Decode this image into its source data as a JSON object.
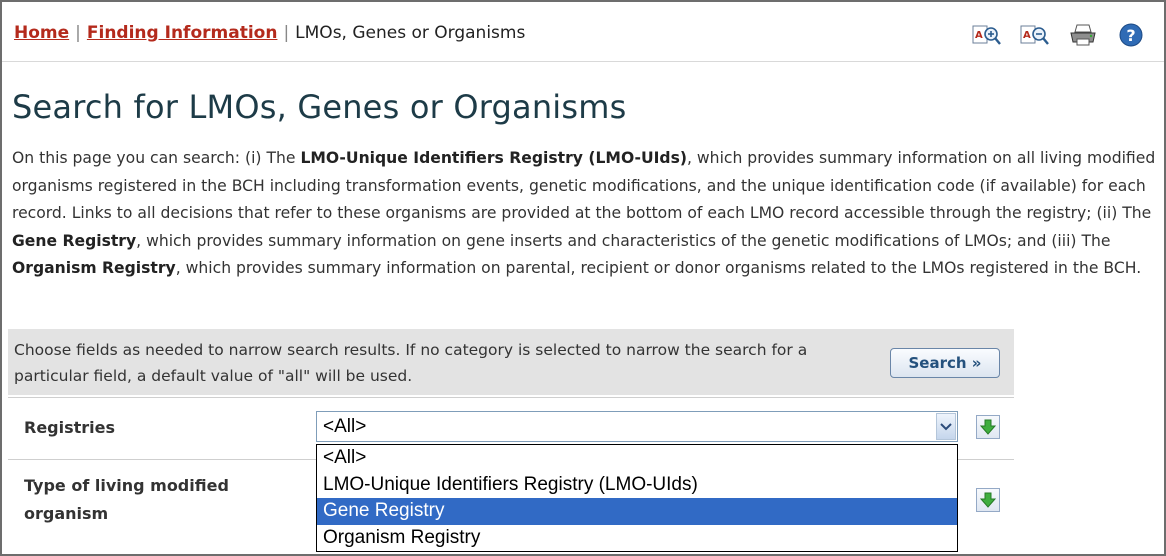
{
  "breadcrumb": {
    "home": "Home",
    "sep1": "|",
    "finding": "Finding Information",
    "sep2": "|",
    "current": "LMOs, Genes or Organisms"
  },
  "toolbar": {
    "icons": [
      "zoom-in-icon",
      "zoom-out-icon",
      "print-icon",
      "help-icon"
    ]
  },
  "page_title": "Search for LMOs, Genes or Organisms",
  "intro": {
    "t1": "On this page you can search: (i) The ",
    "b1": "LMO-Unique Identifiers Registry (LMO-UIds)",
    "t2": ", which provides summary information on all living modified organisms registered in the BCH including transformation events, genetic modifications, and the unique identification code (if available) for each record. Links to all decisions that refer to these organisms are provided at the bottom of each LMO record accessible through the registry; (ii) The ",
    "b2": "Gene Registry",
    "t3": ", which provides summary information on gene inserts and characteristics of the genetic modifications of LMOs; and (iii) The ",
    "b3": "Organism Registry",
    "t4": ", which provides summary information on parental, recipient or donor organisms related to the LMOs registered in the BCH."
  },
  "search": {
    "hint": "Choose fields as needed to narrow search results. If no category is selected to narrow the search for a particular field, a default value of \"all\" will be used.",
    "button": "Search »"
  },
  "fields": {
    "registries_label": "Registries",
    "registries_value": "<All>",
    "lmo_type_label": "Type of living modified organism"
  },
  "dropdown": {
    "options": [
      "<All>",
      "LMO-Unique Identifiers Registry (LMO-UIds)",
      "Gene Registry",
      "Organism Registry"
    ],
    "highlighted": "Gene Registry"
  },
  "colors": {
    "link": "#b42a1c",
    "title": "#1d3b47",
    "highlight": "#316ac5",
    "search_band": "#e3e3e3"
  }
}
